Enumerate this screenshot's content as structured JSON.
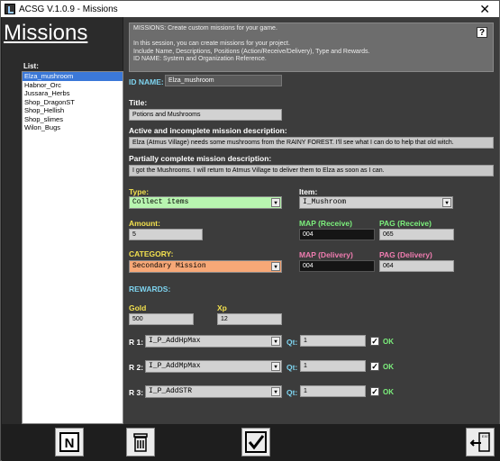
{
  "window": {
    "title": "ACSG V.1.0.9 - Missions",
    "close_label": "✕"
  },
  "heading": "Missions",
  "list": {
    "label": "List:",
    "items": [
      "Elza_mushroom",
      "Habnor_Orc",
      "Jussara_Herbs",
      "Shop_DragonST",
      "Shop_Hellish",
      "Shop_slimes",
      "Wilon_Bugs"
    ],
    "selected_index": 0
  },
  "info": {
    "text": "MISSIONS: Create custom missions for your game.\n\nIn this session, you can create missions for your project.\nInclude Name, Descriptions, Positions (Action/Receive/Delivery), Type and Rewards.\nID NAME: System and Organization Reference.",
    "help_label": "?"
  },
  "form": {
    "id_label": "ID NAME:",
    "id_value": "Elza_mushroom",
    "title_label": "Title:",
    "title_value": "Potions and Mushrooms",
    "active_label": "Active and incomplete mission description:",
    "active_value": "Elza (Atmus Village) needs some mushrooms from the RAINY FOREST. I'll see what I can do to help that old witch.",
    "partial_label": "Partially complete mission description:",
    "partial_value": "I got the Mushrooms. I will return to Atmus Village to deliver them to Elza as soon as I can.",
    "type_label": "Type:",
    "type_value": "Collect items",
    "item_label": "Item:",
    "item_value": "I_Mushroom",
    "amount_label": "Amount:",
    "amount_value": "5",
    "map_receive_label": "MAP (Receive)",
    "map_receive_value": "004",
    "pag_receive_label": "PAG (Receive)",
    "pag_receive_value": "065",
    "category_label": "CATEGORY:",
    "category_value": "Secondary Mission",
    "map_delivery_label": "MAP (Delivery)",
    "map_delivery_value": "004",
    "pag_delivery_label": "PAG (Delivery)",
    "pag_delivery_value": "064",
    "rewards_label": "REWARDS:",
    "gold_label": "Gold",
    "gold_value": "500",
    "xp_label": "Xp",
    "xp_value": "12",
    "rewards": [
      {
        "label": "R 1:",
        "value": "I_P_AddHpMax",
        "qt_label": "Qt:",
        "qt_value": "1",
        "ok_label": "OK",
        "checked": "✓"
      },
      {
        "label": "R 2:",
        "value": "I_P_AddMpMax",
        "qt_label": "Qt:",
        "qt_value": "1",
        "ok_label": "OK",
        "checked": "✓"
      },
      {
        "label": "R 3:",
        "value": "I_P_AddSTR",
        "qt_label": "Qt:",
        "qt_value": "1",
        "ok_label": "OK",
        "checked": "✓"
      }
    ],
    "dropdown_arrow": "▼"
  },
  "toolbar": {
    "new_label": "N",
    "exit_label": "EXIT"
  },
  "colors": {
    "selected": "#3b78d8",
    "type_combo": "#b8f5b0",
    "category_combo": "#f7a877",
    "ok": "#7cf07c"
  },
  "icons": [
    "new-icon",
    "delete-trash-icon",
    "save-checkmark-icon",
    "exit-door-icon"
  ]
}
